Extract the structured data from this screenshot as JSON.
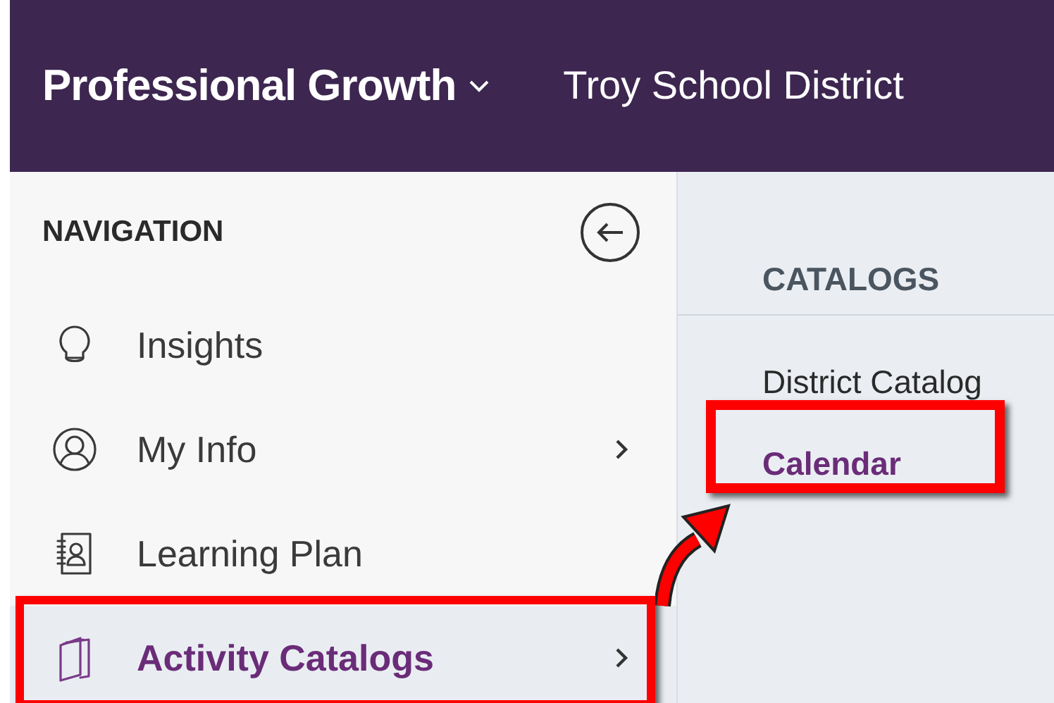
{
  "header": {
    "app_title": "Professional Growth",
    "district": "Troy School District"
  },
  "navigation": {
    "title": "NAVIGATION",
    "items": [
      {
        "label": "Insights",
        "has_submenu": false,
        "selected": false
      },
      {
        "label": "My Info",
        "has_submenu": true,
        "selected": false
      },
      {
        "label": "Learning Plan",
        "has_submenu": false,
        "selected": false
      },
      {
        "label": "Activity Catalogs",
        "has_submenu": true,
        "selected": true
      }
    ]
  },
  "catalogs": {
    "title": "CATALOGS",
    "items": [
      {
        "label": "District Catalog",
        "selected": false
      },
      {
        "label": "Calendar",
        "selected": true
      }
    ]
  }
}
